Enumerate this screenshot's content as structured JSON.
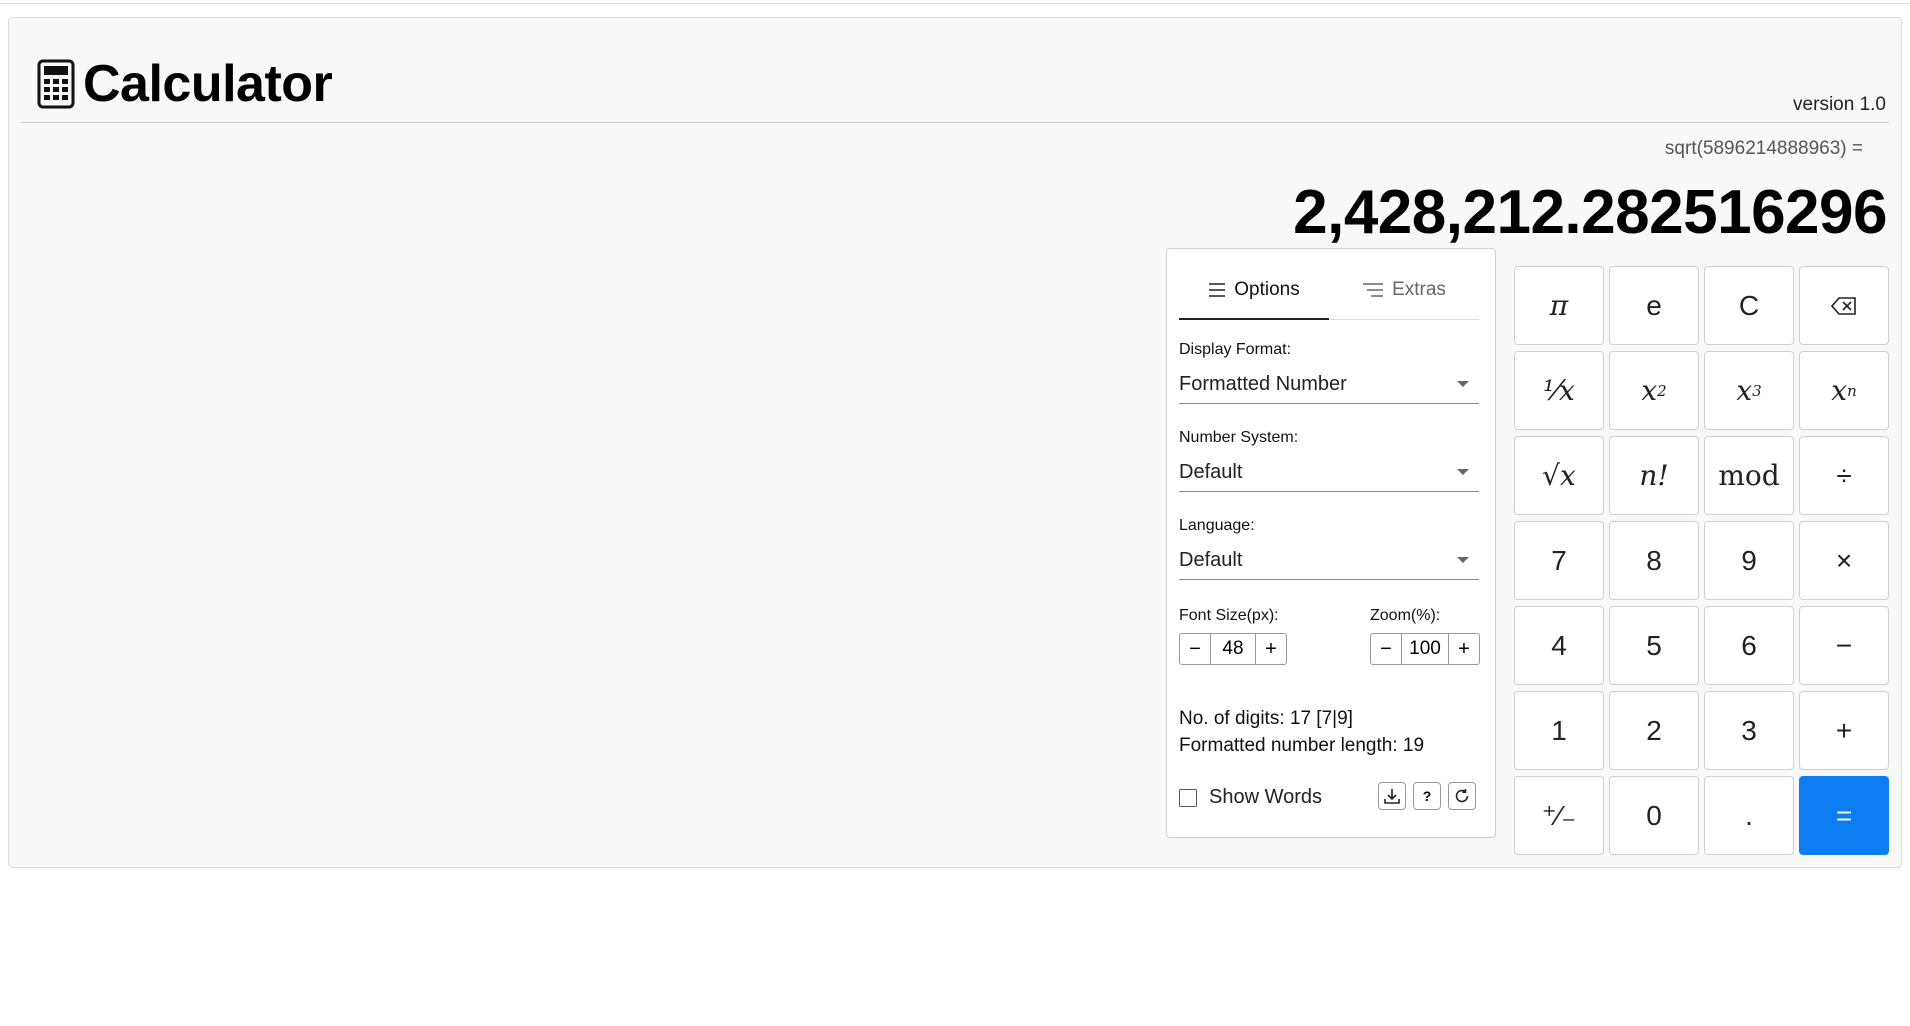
{
  "app": {
    "title": "Calculator",
    "version": "version 1.0",
    "logo_icon": "calculator-icon"
  },
  "display": {
    "expression": "sqrt(5896214888963) =",
    "result": "2,428,212.282516296"
  },
  "tabs": {
    "options": "Options",
    "extras": "Extras"
  },
  "options": {
    "display_format_label": "Display Format:",
    "display_format_value": "Formatted Number",
    "number_system_label": "Number System:",
    "number_system_value": "Default",
    "language_label": "Language:",
    "language_value": "Default",
    "font_size_label": "Font Size(px):",
    "font_size_value": "48",
    "zoom_label": "Zoom(%):",
    "zoom_value": "100",
    "digits_info": "No. of digits: 17 [7|9]",
    "formatted_length_info": "Formatted number length: 19",
    "show_words_label": "Show Words",
    "show_words_checked": false,
    "help_label": "?"
  },
  "keypad": {
    "pi": "π",
    "e": "e",
    "clear": "C",
    "reciprocal": "¹⁄x",
    "square_base": "x",
    "square_exp": "2",
    "cube_base": "x",
    "cube_exp": "3",
    "power_base": "x",
    "power_exp": "n",
    "sqrt": "√x",
    "factorial": "n!",
    "mod": "mod",
    "divide": "÷",
    "seven": "7",
    "eight": "8",
    "nine": "9",
    "multiply": "×",
    "four": "4",
    "five": "5",
    "six": "6",
    "minus": "−",
    "one": "1",
    "two": "2",
    "three": "3",
    "plus": "+",
    "negate": "⁺⁄₋",
    "zero": "0",
    "decimal": ".",
    "equals": "="
  },
  "colors": {
    "accent": "#0d7ef2",
    "panel_bg": "#f8f8f8"
  }
}
